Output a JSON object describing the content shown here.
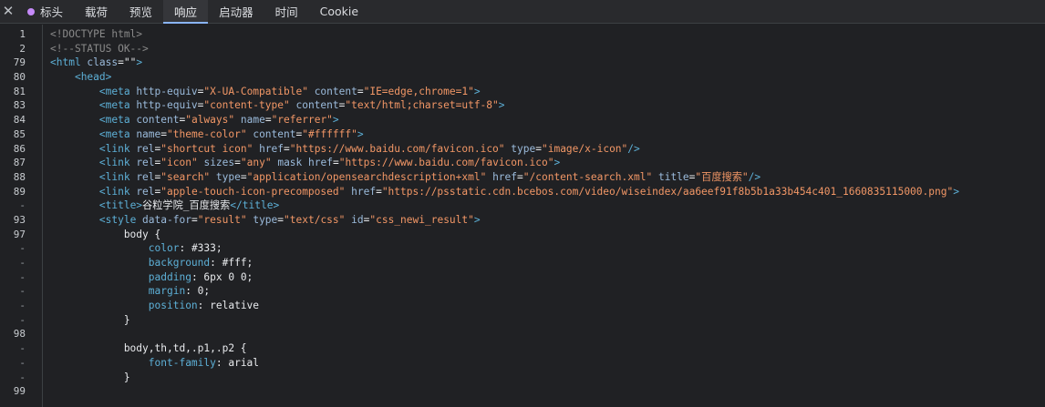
{
  "tabs": [
    {
      "label": "标头",
      "dot": true
    },
    {
      "label": "载荷"
    },
    {
      "label": "预览"
    },
    {
      "label": "响应",
      "active": true
    },
    {
      "label": "启动器"
    },
    {
      "label": "时间"
    },
    {
      "label": "Cookie"
    }
  ],
  "close_glyph": "✕",
  "colors": {
    "dot": "#c58af9",
    "accent": "#8ab4f8",
    "tag": "#5db0d7",
    "attr": "#9bbbdc",
    "value": "#f29766",
    "comment": "#898989"
  },
  "lines": [
    {
      "num": "1",
      "tokens": [
        [
          "c",
          "<!DOCTYPE html>"
        ]
      ]
    },
    {
      "num": "2",
      "tokens": [
        [
          "c",
          "<!--STATUS OK-->"
        ]
      ]
    },
    {
      "num": "79",
      "tokens": [
        [
          "t",
          "<html "
        ],
        [
          "a",
          "class"
        ],
        [
          "p",
          "=\""
        ],
        [
          "v",
          ""
        ],
        [
          "p",
          "\""
        ],
        [
          "t",
          ">"
        ]
      ]
    },
    {
      "num": "80",
      "tokens": [
        [
          "x",
          "    "
        ],
        [
          "t",
          "<head>"
        ]
      ]
    },
    {
      "num": "81",
      "tokens": [
        [
          "x",
          "        "
        ],
        [
          "t",
          "<meta "
        ],
        [
          "a",
          "http-equiv"
        ],
        [
          "p",
          "="
        ],
        [
          "v",
          "\"X-UA-Compatible\""
        ],
        [
          "x",
          " "
        ],
        [
          "a",
          "content"
        ],
        [
          "p",
          "="
        ],
        [
          "v",
          "\"IE=edge,chrome=1\""
        ],
        [
          "t",
          ">"
        ]
      ]
    },
    {
      "num": "83",
      "tokens": [
        [
          "x",
          "        "
        ],
        [
          "t",
          "<meta "
        ],
        [
          "a",
          "http-equiv"
        ],
        [
          "p",
          "="
        ],
        [
          "v",
          "\"content-type\""
        ],
        [
          "x",
          " "
        ],
        [
          "a",
          "content"
        ],
        [
          "p",
          "="
        ],
        [
          "v",
          "\"text/html;charset=utf-8\""
        ],
        [
          "t",
          ">"
        ]
      ]
    },
    {
      "num": "84",
      "tokens": [
        [
          "x",
          "        "
        ],
        [
          "t",
          "<meta "
        ],
        [
          "a",
          "content"
        ],
        [
          "p",
          "="
        ],
        [
          "v",
          "\"always\""
        ],
        [
          "x",
          " "
        ],
        [
          "a",
          "name"
        ],
        [
          "p",
          "="
        ],
        [
          "v",
          "\"referrer\""
        ],
        [
          "t",
          ">"
        ]
      ]
    },
    {
      "num": "85",
      "tokens": [
        [
          "x",
          "        "
        ],
        [
          "t",
          "<meta "
        ],
        [
          "a",
          "name"
        ],
        [
          "p",
          "="
        ],
        [
          "v",
          "\"theme-color\""
        ],
        [
          "x",
          " "
        ],
        [
          "a",
          "content"
        ],
        [
          "p",
          "="
        ],
        [
          "v",
          "\"#ffffff\""
        ],
        [
          "t",
          ">"
        ]
      ]
    },
    {
      "num": "86",
      "tokens": [
        [
          "x",
          "        "
        ],
        [
          "t",
          "<link "
        ],
        [
          "a",
          "rel"
        ],
        [
          "p",
          "="
        ],
        [
          "v",
          "\"shortcut icon\""
        ],
        [
          "x",
          " "
        ],
        [
          "a",
          "href"
        ],
        [
          "p",
          "="
        ],
        [
          "v",
          "\"https://www.baidu.com/favicon.ico\""
        ],
        [
          "x",
          " "
        ],
        [
          "a",
          "type"
        ],
        [
          "p",
          "="
        ],
        [
          "v",
          "\"image/x-icon\""
        ],
        [
          "t",
          "/>"
        ]
      ]
    },
    {
      "num": "87",
      "tokens": [
        [
          "x",
          "        "
        ],
        [
          "t",
          "<link "
        ],
        [
          "a",
          "rel"
        ],
        [
          "p",
          "="
        ],
        [
          "v",
          "\"icon\""
        ],
        [
          "x",
          " "
        ],
        [
          "a",
          "sizes"
        ],
        [
          "p",
          "="
        ],
        [
          "v",
          "\"any\""
        ],
        [
          "x",
          " "
        ],
        [
          "a",
          "mask href"
        ],
        [
          "p",
          "="
        ],
        [
          "v",
          "\"https://www.baidu.com/favicon.ico\""
        ],
        [
          "t",
          ">"
        ]
      ]
    },
    {
      "num": "88",
      "tokens": [
        [
          "x",
          "        "
        ],
        [
          "t",
          "<link "
        ],
        [
          "a",
          "rel"
        ],
        [
          "p",
          "="
        ],
        [
          "v",
          "\"search\""
        ],
        [
          "x",
          " "
        ],
        [
          "a",
          "type"
        ],
        [
          "p",
          "="
        ],
        [
          "v",
          "\"application/opensearchdescription+xml\""
        ],
        [
          "x",
          " "
        ],
        [
          "a",
          "href"
        ],
        [
          "p",
          "="
        ],
        [
          "v",
          "\"/content-search.xml\""
        ],
        [
          "x",
          " "
        ],
        [
          "a",
          "title"
        ],
        [
          "p",
          "="
        ],
        [
          "v",
          "\"百度搜索\""
        ],
        [
          "t",
          "/>"
        ]
      ]
    },
    {
      "num": "89",
      "tokens": [
        [
          "x",
          "        "
        ],
        [
          "t",
          "<link "
        ],
        [
          "a",
          "rel"
        ],
        [
          "p",
          "="
        ],
        [
          "v",
          "\"apple-touch-icon-precomposed\""
        ],
        [
          "x",
          " "
        ],
        [
          "a",
          "href"
        ],
        [
          "p",
          "="
        ],
        [
          "v",
          "\"https://psstatic.cdn.bcebos.com/video/wiseindex/aa6eef91f8b5b1a33b454c401_1660835115000.png\""
        ],
        [
          "t",
          ">"
        ]
      ]
    },
    {
      "num": "-",
      "tokens": [
        [
          "x",
          "        "
        ],
        [
          "t",
          "<title>"
        ],
        [
          "x",
          "谷粒学院_百度搜索"
        ],
        [
          "t",
          "</title>"
        ]
      ]
    },
    {
      "num": "93",
      "tokens": [
        [
          "x",
          "        "
        ],
        [
          "t",
          "<style "
        ],
        [
          "a",
          "data-for"
        ],
        [
          "p",
          "="
        ],
        [
          "v",
          "\"result\""
        ],
        [
          "x",
          " "
        ],
        [
          "a",
          "type"
        ],
        [
          "p",
          "="
        ],
        [
          "v",
          "\"text/css\""
        ],
        [
          "x",
          " "
        ],
        [
          "a",
          "id"
        ],
        [
          "p",
          "="
        ],
        [
          "v",
          "\"css_newi_result\""
        ],
        [
          "t",
          ">"
        ]
      ]
    },
    {
      "num": "97",
      "tokens": [
        [
          "x",
          "            body {"
        ]
      ]
    },
    {
      "num": "-",
      "tokens": [
        [
          "x",
          "                "
        ],
        [
          "k",
          "color"
        ],
        [
          "x",
          ": #333;"
        ]
      ]
    },
    {
      "num": "-",
      "tokens": [
        [
          "x",
          "                "
        ],
        [
          "k",
          "background"
        ],
        [
          "x",
          ": #fff;"
        ]
      ]
    },
    {
      "num": "-",
      "tokens": [
        [
          "x",
          "                "
        ],
        [
          "k",
          "padding"
        ],
        [
          "x",
          ": 6px 0 0;"
        ]
      ]
    },
    {
      "num": "-",
      "tokens": [
        [
          "x",
          "                "
        ],
        [
          "k",
          "margin"
        ],
        [
          "x",
          ": 0;"
        ]
      ]
    },
    {
      "num": "-",
      "tokens": [
        [
          "x",
          "                "
        ],
        [
          "k",
          "position"
        ],
        [
          "x",
          ": relative"
        ]
      ]
    },
    {
      "num": "-",
      "tokens": [
        [
          "x",
          "            }"
        ]
      ]
    },
    {
      "num": "98",
      "tokens": [
        [
          "x",
          ""
        ]
      ]
    },
    {
      "num": "-",
      "tokens": [
        [
          "x",
          "            body,th,td,.p1,.p2 {"
        ]
      ]
    },
    {
      "num": "-",
      "tokens": [
        [
          "x",
          "                "
        ],
        [
          "k",
          "font-family"
        ],
        [
          "x",
          ": arial"
        ]
      ]
    },
    {
      "num": "-",
      "tokens": [
        [
          "x",
          "            }"
        ]
      ]
    },
    {
      "num": "99",
      "tokens": [
        [
          "x",
          ""
        ]
      ]
    }
  ]
}
